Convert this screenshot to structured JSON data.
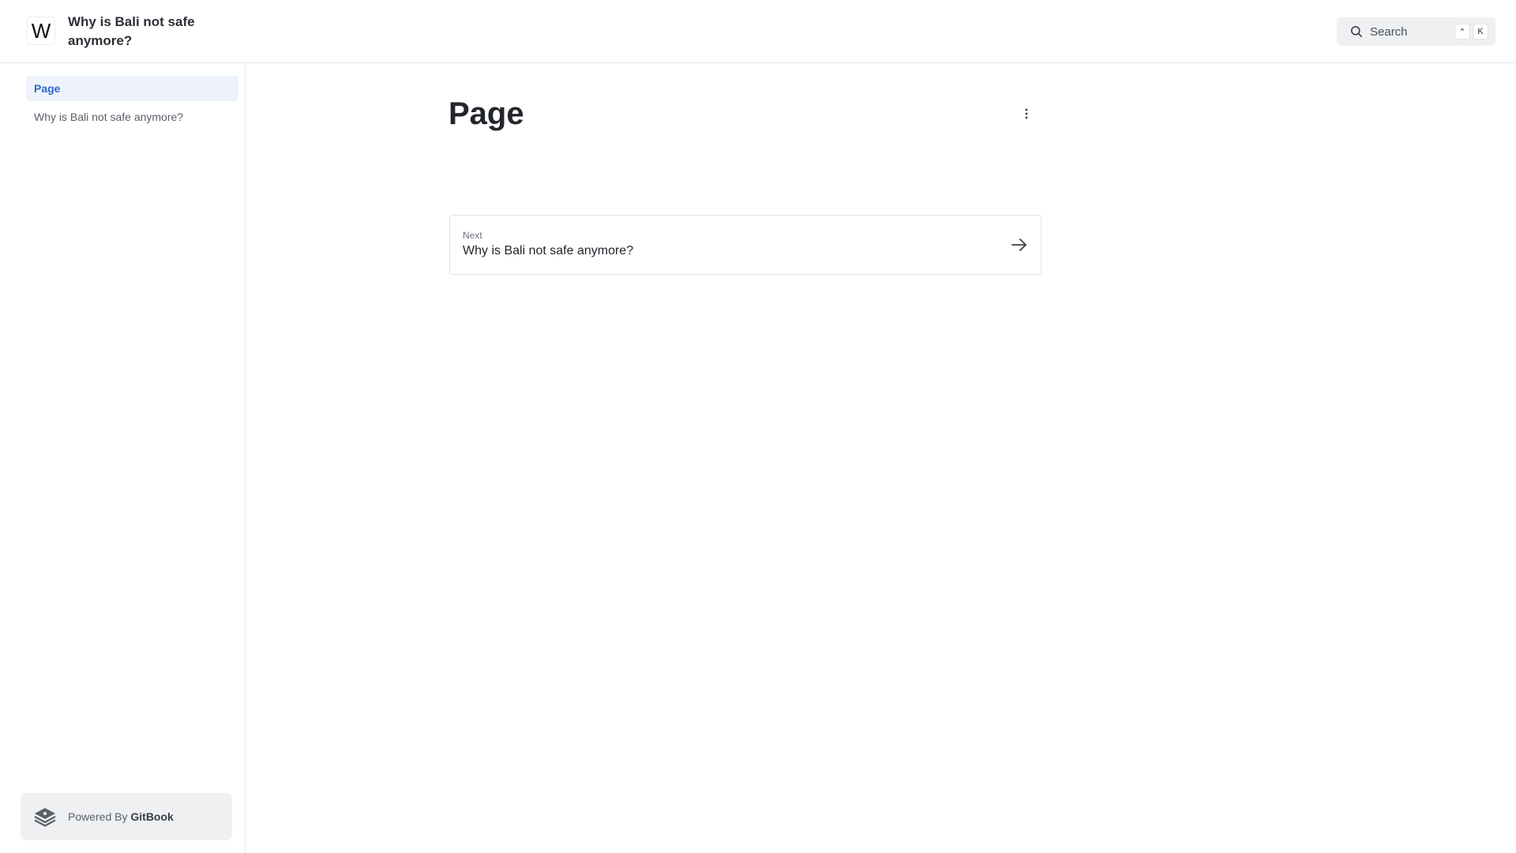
{
  "header": {
    "logo_letter": "W",
    "site_title": "Why is Bali not safe anymore?",
    "search": {
      "label": "Search",
      "shortcut_keys": [
        "⌃",
        "K"
      ]
    }
  },
  "sidebar": {
    "items": [
      {
        "label": "Page",
        "active": true
      },
      {
        "label": "Why is Bali not safe anymore?",
        "active": false
      }
    ],
    "powered_by": {
      "prefix": "Powered By",
      "brand": "GitBook"
    }
  },
  "main": {
    "title": "Page",
    "next": {
      "label": "Next",
      "title": "Why is Bali not safe anymore?"
    }
  },
  "colors": {
    "accent": "#2f66c6",
    "active_bg": "#eef3fb",
    "border": "#e6e8eb",
    "muted_bg": "#eef0f2"
  },
  "icons": {
    "search": "search-icon",
    "more": "more-vertical-icon",
    "next_arrow": "arrow-right-icon",
    "gitbook": "gitbook-logo-icon"
  }
}
